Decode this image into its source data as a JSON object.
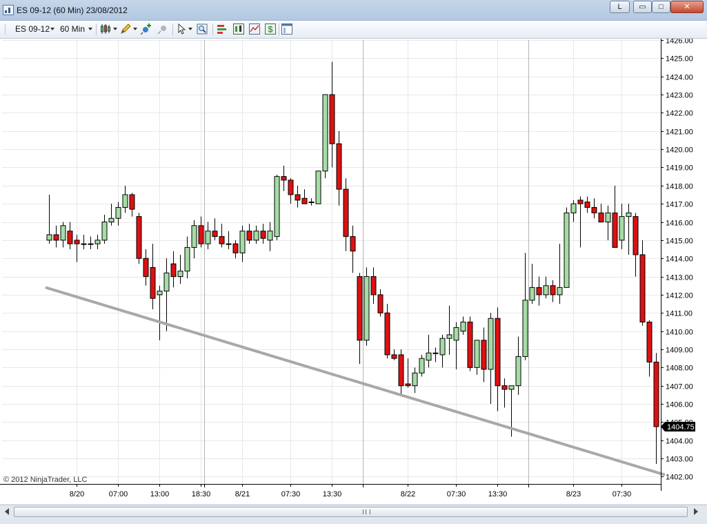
{
  "window": {
    "title": "ES 09-12 (60 Min)  23/08/2012",
    "link_button_label": "L",
    "minimize_glyph": "▭",
    "maximize_glyph": "□",
    "close_glyph": "✕"
  },
  "toolbar": {
    "instrument": "ES 09-12",
    "interval": "60 Min"
  },
  "icons": {
    "app": "chart-app-icon",
    "bar_style": "candlestick-icon",
    "draw": "pencil-icon",
    "global_draw": "pin-plus-icon",
    "hide_drawing": "pin-icon",
    "cursor": "cursor-icon",
    "zoom": "zoom-icon",
    "strategy": "strategy-icon",
    "data_series": "data-series-icon",
    "indicators": "indicator-icon",
    "market_analyzer": "dollar-icon",
    "properties": "properties-icon"
  },
  "colors": {
    "up_candle": "#a6dca6",
    "down_candle": "#dd1111",
    "trend_line": "#a8a8a8",
    "price_marker": "#000000",
    "grid": "#e7e7e7",
    "session_break": "#b3b3b3"
  },
  "copyright": "© 2012 NinjaTrader, LLC",
  "scrollbar": {
    "thumb_grip": "III"
  },
  "chart_data": {
    "type": "candlestick",
    "instrument": "ES 09-12",
    "interval": "60 Min",
    "ylim": [
      1401.6,
      1426.0
    ],
    "y_ticks": [
      "1426.00",
      "1425.00",
      "1424.00",
      "1423.00",
      "1422.00",
      "1421.00",
      "1420.00",
      "1419.00",
      "1418.00",
      "1417.00",
      "1416.00",
      "1415.00",
      "1414.00",
      "1413.00",
      "1412.00",
      "1411.00",
      "1410.00",
      "1409.00",
      "1408.00",
      "1407.00",
      "1406.00",
      "1405.00",
      "1404.00",
      "1403.00",
      "1402.00"
    ],
    "x_labels": [
      {
        "bar": 4,
        "label": "8/20"
      },
      {
        "bar": 10,
        "label": "07:00"
      },
      {
        "bar": 16,
        "label": "13:00"
      },
      {
        "bar": 22,
        "label": "18:30"
      },
      {
        "bar": 28,
        "label": "8/21"
      },
      {
        "bar": 35,
        "label": "07:30"
      },
      {
        "bar": 41,
        "label": "13:30"
      },
      {
        "bar": 52,
        "label": "8/22"
      },
      {
        "bar": 59,
        "label": "07:30"
      },
      {
        "bar": 65,
        "label": "13:30"
      },
      {
        "bar": 76,
        "label": "8/23"
      },
      {
        "bar": 83,
        "label": "07:30"
      }
    ],
    "session_breaks": [
      22.5,
      45.5,
      69.5
    ],
    "last_price": "1404.75",
    "candles": [
      [
        1415.0,
        1417.5,
        1414.8,
        1415.3
      ],
      [
        1415.3,
        1415.8,
        1414.6,
        1415.0
      ],
      [
        1415.0,
        1416.0,
        1414.6,
        1415.8
      ],
      [
        1415.5,
        1416.0,
        1414.5,
        1414.8
      ],
      [
        1415.0,
        1415.3,
        1413.8,
        1414.8
      ],
      [
        1414.8,
        1415.3,
        1414.5,
        1414.8
      ],
      [
        1414.8,
        1415.2,
        1414.5,
        1414.8
      ],
      [
        1414.8,
        1415.3,
        1414.5,
        1415.0
      ],
      [
        1415.0,
        1416.4,
        1414.8,
        1416.0
      ],
      [
        1416.0,
        1417.0,
        1415.8,
        1416.2
      ],
      [
        1416.2,
        1417.1,
        1415.8,
        1416.8
      ],
      [
        1416.8,
        1418.0,
        1416.5,
        1417.5
      ],
      [
        1417.5,
        1417.6,
        1416.3,
        1416.7
      ],
      [
        1416.3,
        1416.5,
        1413.7,
        1414.0
      ],
      [
        1414.0,
        1414.5,
        1412.5,
        1413.0
      ],
      [
        1413.5,
        1414.8,
        1411.2,
        1411.8
      ],
      [
        1412.0,
        1412.5,
        1409.5,
        1412.2
      ],
      [
        1412.2,
        1414.0,
        1410.0,
        1413.2
      ],
      [
        1413.7,
        1414.4,
        1412.4,
        1413.0
      ],
      [
        1413.0,
        1414.2,
        1412.6,
        1413.3
      ],
      [
        1413.3,
        1415.2,
        1412.9,
        1414.6
      ],
      [
        1414.6,
        1416.1,
        1414.0,
        1415.8
      ],
      [
        1415.8,
        1416.3,
        1414.6,
        1414.8
      ],
      [
        1414.8,
        1416.0,
        1414.5,
        1415.5
      ],
      [
        1415.5,
        1416.2,
        1415.0,
        1415.2
      ],
      [
        1415.2,
        1415.9,
        1414.6,
        1414.8
      ],
      [
        1414.8,
        1415.5,
        1414.5,
        1414.8
      ],
      [
        1414.8,
        1415.0,
        1414.0,
        1414.3
      ],
      [
        1414.3,
        1415.8,
        1413.8,
        1415.5
      ],
      [
        1415.5,
        1415.9,
        1414.8,
        1415.0
      ],
      [
        1415.0,
        1415.8,
        1414.8,
        1415.5
      ],
      [
        1415.5,
        1415.9,
        1414.8,
        1415.1
      ],
      [
        1415.0,
        1416.0,
        1414.4,
        1415.5
      ],
      [
        1415.2,
        1418.6,
        1415.0,
        1418.5
      ],
      [
        1418.5,
        1419.1,
        1417.7,
        1418.3
      ],
      [
        1418.3,
        1418.4,
        1417.0,
        1417.5
      ],
      [
        1417.5,
        1418.0,
        1416.8,
        1417.2
      ],
      [
        1417.3,
        1417.8,
        1417.0,
        1417.0
      ],
      [
        1417.1,
        1417.3,
        1416.9,
        1417.1
      ],
      [
        1417.0,
        1418.3,
        1417.0,
        1418.8
      ],
      [
        1418.8,
        1420.4,
        1418.4,
        1423.0
      ],
      [
        1423.0,
        1424.8,
        1419.0,
        1420.3
      ],
      [
        1420.3,
        1421.0,
        1416.9,
        1417.8
      ],
      [
        1417.8,
        1418.4,
        1414.4,
        1415.2
      ],
      [
        1415.2,
        1415.8,
        1413.2,
        1414.4
      ],
      [
        1413.0,
        1413.2,
        1408.2,
        1409.5
      ],
      [
        1409.5,
        1413.5,
        1409.2,
        1413.0
      ],
      [
        1413.0,
        1413.5,
        1411.5,
        1412.0
      ],
      [
        1412.0,
        1412.3,
        1410.8,
        1411.0
      ],
      [
        1411.0,
        1411.5,
        1408.5,
        1408.7
      ],
      [
        1408.7,
        1409.0,
        1408.4,
        1408.5
      ],
      [
        1408.7,
        1409.0,
        1406.5,
        1407.0
      ],
      [
        1407.1,
        1408.5,
        1406.9,
        1407.0
      ],
      [
        1407.0,
        1408.0,
        1406.6,
        1407.7
      ],
      [
        1407.7,
        1408.7,
        1407.5,
        1408.5
      ],
      [
        1408.4,
        1409.8,
        1408.0,
        1408.8
      ],
      [
        1408.8,
        1409.1,
        1408.3,
        1408.8
      ],
      [
        1408.7,
        1409.8,
        1408.0,
        1409.6
      ],
      [
        1409.6,
        1411.4,
        1408.7,
        1409.8
      ],
      [
        1409.5,
        1410.5,
        1407.9,
        1410.2
      ],
      [
        1410.0,
        1410.8,
        1409.8,
        1410.5
      ],
      [
        1410.5,
        1410.8,
        1407.8,
        1408.0
      ],
      [
        1408.0,
        1408.7,
        1407.6,
        1409.5
      ],
      [
        1409.5,
        1410.2,
        1407.2,
        1407.9
      ],
      [
        1407.9,
        1411.0,
        1406.0,
        1410.7
      ],
      [
        1410.7,
        1411.3,
        1405.6,
        1407.0
      ],
      [
        1407.0,
        1407.4,
        1405.8,
        1406.8
      ],
      [
        1406.8,
        1407.0,
        1404.2,
        1407.0
      ],
      [
        1407.0,
        1409.7,
        1406.5,
        1408.6
      ],
      [
        1408.6,
        1414.3,
        1408.4,
        1411.7
      ],
      [
        1411.7,
        1413.7,
        1411.5,
        1412.4
      ],
      [
        1412.4,
        1413.0,
        1411.4,
        1412.0
      ],
      [
        1412.0,
        1413.0,
        1411.8,
        1412.5
      ],
      [
        1412.5,
        1412.8,
        1411.6,
        1412.0
      ],
      [
        1412.0,
        1414.8,
        1411.5,
        1412.4
      ],
      [
        1412.4,
        1416.8,
        1412.4,
        1416.5
      ],
      [
        1416.5,
        1417.2,
        1416.0,
        1417.0
      ],
      [
        1417.2,
        1417.4,
        1414.6,
        1417.0
      ],
      [
        1417.1,
        1417.4,
        1416.5,
        1416.8
      ],
      [
        1416.8,
        1417.3,
        1416.2,
        1416.5
      ],
      [
        1416.5,
        1417.0,
        1416.3,
        1416.0
      ],
      [
        1416.0,
        1416.9,
        1415.0,
        1416.5
      ],
      [
        1416.5,
        1418.0,
        1415.0,
        1414.6
      ],
      [
        1415.0,
        1417.0,
        1414.5,
        1416.3
      ],
      [
        1416.3,
        1417.0,
        1414.2,
        1416.5
      ],
      [
        1416.3,
        1416.5,
        1413.0,
        1414.2
      ],
      [
        1414.2,
        1415.0,
        1410.3,
        1410.5
      ],
      [
        1410.5,
        1410.6,
        1407.5,
        1408.3
      ],
      [
        1408.3,
        1408.8,
        1402.7,
        1404.75
      ]
    ],
    "trend_line": {
      "from": {
        "bar": -0.5,
        "y": 1412.4
      },
      "to": {
        "bar": 89.3,
        "y": 1402.1
      }
    }
  }
}
